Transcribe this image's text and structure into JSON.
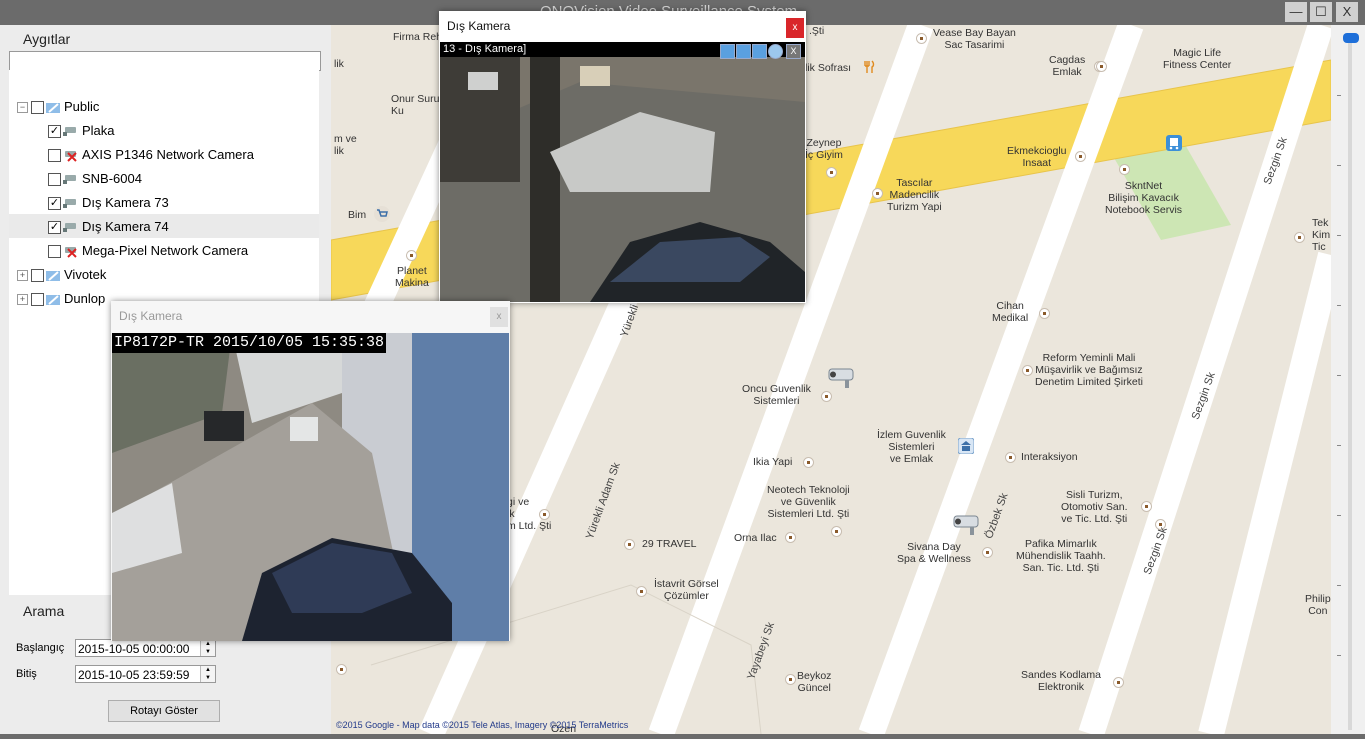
{
  "window": {
    "title": "ONOVision Video Surveillance System",
    "minimize": "—",
    "maximize": "☐",
    "close": "X"
  },
  "devices": {
    "title": "Aygıtlar",
    "search_value": "",
    "tree": [
      {
        "label": "Public",
        "expander": "−",
        "checked": false
      },
      {
        "label": "Plaka",
        "checked": true
      },
      {
        "label": "AXIS P1346 Network Camera",
        "checked": false
      },
      {
        "label": "SNB-6004",
        "checked": false
      },
      {
        "label": "Dış Kamera 73",
        "checked": true
      },
      {
        "label": "Dış Kamera 74",
        "checked": true
      },
      {
        "label": "Mega-Pixel Network Camera",
        "checked": false
      },
      {
        "label": "Vivotek",
        "expander": "+",
        "checked": false
      },
      {
        "label": "Dunlop",
        "expander": "+",
        "checked": false
      }
    ]
  },
  "search": {
    "title": "Arama",
    "start_label": "Başlangıç",
    "start_value": "2015-10-05 00:00:00",
    "end_label": "Bitiş",
    "end_value": "2015-10-05 23:59:59",
    "route_button": "Rotayı Göster"
  },
  "map": {
    "copyright": "©2015 Google - Map data ©2015 Tele Atlas, Imagery ©2015 TerraMetrics",
    "labels": [
      "Vease Bay Bayan\nSac Tasarimi",
      "Magic Life\nFitness Center",
      "Cagdas\nEmlak",
      "Ekmekcioglu\nInsaat",
      "SkntNet\nBilişim Kavacık\nNotebook Servis",
      "Zeynep\nİç Giyim",
      "Tascılar\nMadencilik\nTurizm Yapi",
      "Cihan\nMedikal",
      "Reform Yeminli Mali\nMüşavirlik ve Bağımsız\nDenetim Limited Şirketi",
      "Oncu Guvenlik\nSistemleri",
      "İzlem Guvenlik\nSistemleri\nve Emlak",
      "Interaksiyon",
      "Ikia Yapi",
      "Neotech Teknoloji\nve Güvenlik\nSistemleri Ltd. Şti",
      "Sisli Turizm,\nOtomotiv San.\nve Tic. Ltd. Şti",
      "Orna Ilac",
      "Sivana Day\nSpa & Wellness",
      "Pafika Mimarlık\nMühendislik Taahh.\nSan. Tic. Ltd. Şti",
      "29 TRAVEL",
      "İstavrit Görsel\nÇözümler",
      "Beykoz\nGüncel",
      "Sandes Kodlama\nElektronik",
      "Planet\nMakina",
      "Bim",
      "Onur Suru\nKu",
      "Firma Reh",
      "lik Sofrası",
      "lik",
      "m ve\nlik",
      "Tek\nKim\nTic",
      "Philip\nCon",
      "gi ve\nik\nm Ltd. Şti",
      "Özen",
      ".Şti"
    ],
    "streets": [
      "Yürekli Adam Sk",
      "Yürekli",
      "Yayabeyi Sk",
      "Özbek Sk",
      "Sezgin Sk",
      "Sezgin Sk",
      "Sezgin Sk",
      "Sezgin Sk"
    ]
  },
  "video_top": {
    "title": "Dış Kamera",
    "caption": "13 - Dış Kamera]",
    "close": "x",
    "osd_close": "X"
  },
  "video_main": {
    "title": "Dış Kamera",
    "osd": "IP8172P-TR 2015/10/05 15:35:38",
    "close": "x"
  },
  "icons": {
    "folder": "camera-group-icon",
    "camera": "camera-icon",
    "camera_offline": "camera-offline-icon",
    "map_camera": "camera-marker-icon",
    "poi": "poi-icon"
  },
  "colors": {
    "accent": "#1e6fd9",
    "close": "#d9262a",
    "road_major": "#f7d85a",
    "park": "#cde6b4"
  }
}
